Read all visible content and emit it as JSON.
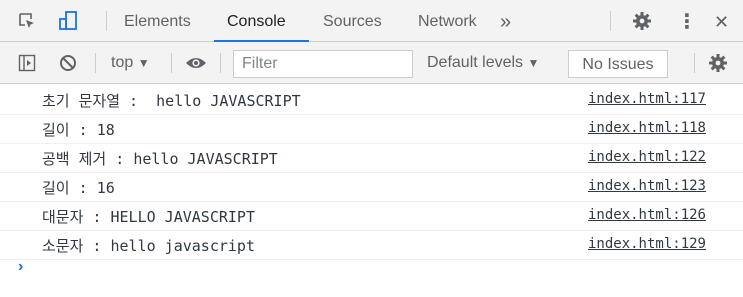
{
  "tabbar": {
    "tabs": [
      {
        "label": "Elements"
      },
      {
        "label": "Console"
      },
      {
        "label": "Sources"
      },
      {
        "label": "Network"
      }
    ],
    "more_tabs_glyph": "»",
    "more_menu_glyph": "⋮",
    "close_glyph": "✕",
    "icons": [
      "inspect-element-icon",
      "device-toggle-icon",
      "gear-icon",
      "kebab-menu-icon",
      "close-icon"
    ],
    "accent_color": "#1a73e8"
  },
  "toolbar": {
    "context_label": "top",
    "filter_placeholder": "Filter",
    "levels_label": "Default levels",
    "issues_label": "No Issues",
    "dropdown_glyph": "▼",
    "icons": [
      "sidebar-toggle-icon",
      "clear-console-icon",
      "eye-icon",
      "gear-icon"
    ]
  },
  "console": {
    "messages": [
      {
        "text": "초기 문자열 :  hello JAVASCRIPT",
        "source": "index.html:117"
      },
      {
        "text": "길이 : 18",
        "source": "index.html:118"
      },
      {
        "text": "공백 제거 : hello JAVASCRIPT",
        "source": "index.html:122"
      },
      {
        "text": "길이 : 16",
        "source": "index.html:123"
      },
      {
        "text": "대문자 : HELLO JAVASCRIPT",
        "source": "index.html:126"
      },
      {
        "text": "소문자 : hello javascript",
        "source": "index.html:129"
      }
    ],
    "prompt_glyph": "›"
  }
}
